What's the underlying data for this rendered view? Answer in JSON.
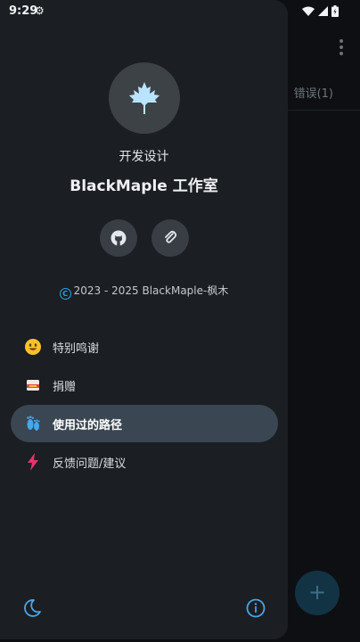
{
  "status": {
    "time": "9:29",
    "gear_icon": "settings-gear-icon"
  },
  "background": {
    "tab_label": "错误(1)",
    "fab_symbol": "+"
  },
  "drawer": {
    "developer_label": "开发设计",
    "studio_name": "BlackMaple 工作室",
    "buttons": [
      {
        "icon": "github-icon"
      },
      {
        "icon": "attachment-icon"
      }
    ],
    "copyright": "2023 - 2025 BlackMaple-枫木",
    "menu": [
      {
        "label": "特别鸣谢",
        "icon": "smile-emoji-icon",
        "active": false
      },
      {
        "label": "捐赠",
        "icon": "donate-icon",
        "active": false
      },
      {
        "label": "使用过的路径",
        "icon": "footprints-icon",
        "active": true
      },
      {
        "label": "反馈问题/建议",
        "icon": "lightning-icon",
        "active": false
      }
    ],
    "footer": {
      "left_icon": "dark-mode-moon-icon",
      "right_icon": "info-icon"
    }
  },
  "colors": {
    "accent": "#2aa6e0",
    "drawer_bg": "#1b1e23",
    "active_item_bg": "#3a4752"
  }
}
